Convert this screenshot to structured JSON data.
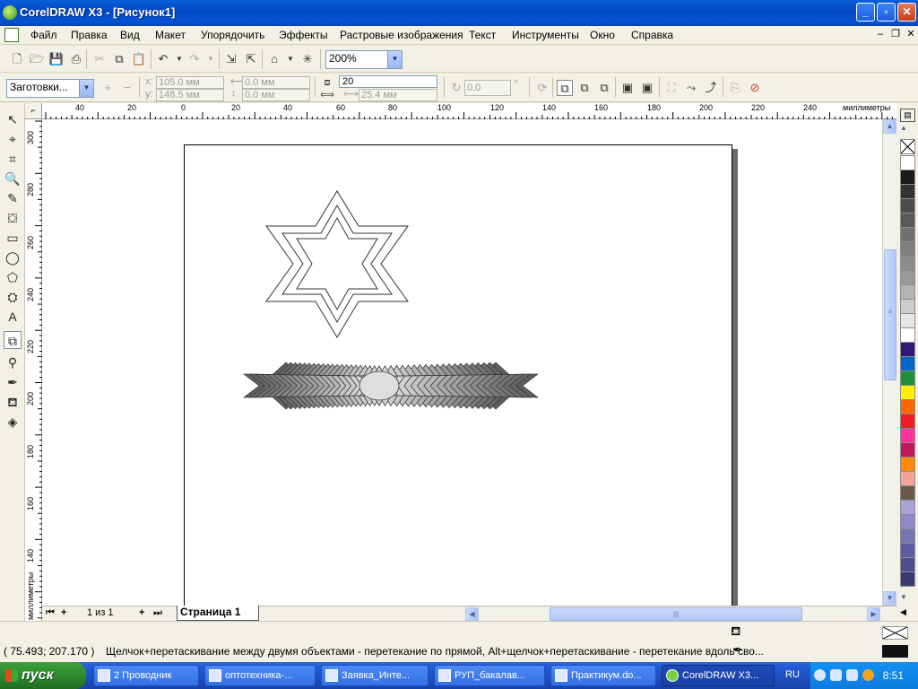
{
  "window": {
    "title": "CorelDRAW X3 - [Рисунок1]",
    "minimize": "_",
    "maximize": "▫",
    "close": "✕"
  },
  "menu": [
    "Файл",
    "Правка",
    "Вид",
    "Макет",
    "Упорядочить",
    "Эффекты",
    "Растровые изображения",
    "Текст",
    "Инструменты",
    "Окно",
    "Справка"
  ],
  "toolbar": {
    "zoom_value": "200%"
  },
  "propbar": {
    "preset": "Заготовки...",
    "x_label": "x:",
    "x_value": "105.0 мм",
    "y_label": "y:",
    "y_value": "148.5 мм",
    "w_value": "0.0 мм",
    "h_value": "0.0 мм",
    "steps_value": "20",
    "spacing_value": "25.4 мм",
    "rotation_value": "0.0",
    "rotation_unit": "°"
  },
  "ruler": {
    "unit": "миллиметры",
    "h_ticks": [
      "40",
      "20",
      "0",
      "20",
      "40",
      "60",
      "80",
      "100",
      "120",
      "140",
      "160",
      "180",
      "200",
      "220",
      "240"
    ],
    "v_ticks": [
      "300",
      "280",
      "260",
      "240",
      "220",
      "200",
      "180",
      "160",
      "140"
    ],
    "v_unit": "миллиметры"
  },
  "pagebar": {
    "page_count": "1 из 1",
    "page_tab": "Страница 1"
  },
  "status": {
    "coords": "( 75.493; 207.170 )",
    "hint": "Щелчок+перетаскивание между двумя объектами - перетекание по прямой, Alt+щелчок+перетаскивание - перетекание вдоль сво..."
  },
  "palette": [
    "#ffffff",
    "#1a1a1a",
    "#333333",
    "#4d4d4d",
    "#595959",
    "#707070",
    "#808080",
    "#8c8c8c",
    "#999999",
    "#b3b3b3",
    "#cccccc",
    "#e6e6e6",
    "#ffffff",
    "#2e1a73",
    "#0066cc",
    "#1f8f3a",
    "#ffee00",
    "#ff6600",
    "#ee1c24",
    "#ff3399",
    "#c2185b",
    "#ff8c00",
    "#f4a39b",
    "#6b5a4c",
    "#a9a3d8",
    "#8f89c9",
    "#7575b8",
    "#5c5ca3",
    "#4d4d8f",
    "#3a3a73"
  ],
  "taskbar": {
    "start": "пуск",
    "tasks": [
      "2 Проводник",
      "оптотехника-...",
      "Заявка_Инте...",
      "РУП_бакалав...",
      "Практикум.do...",
      "CorelDRAW X3..."
    ],
    "lang": "RU",
    "clock": "8:51"
  }
}
